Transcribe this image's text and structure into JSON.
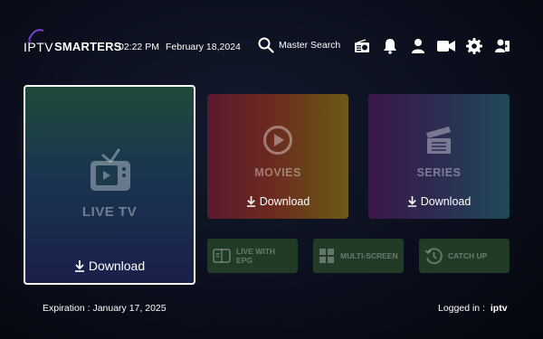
{
  "header": {
    "logo_prefix": "IPTV",
    "logo_suffix": "SMARTERS",
    "time": "02:22 PM",
    "date": "February 18,2024",
    "search_label": "Master Search",
    "icons": [
      "radio-icon",
      "bell-icon",
      "user-icon",
      "video-camera-icon",
      "gear-icon",
      "switch-user-icon"
    ]
  },
  "cards": {
    "live_tv": {
      "title": "LIVE TV",
      "action": "Download"
    },
    "movies": {
      "title": "MOVIES",
      "action": "Download"
    },
    "series": {
      "title": "SERIES",
      "action": "Download"
    }
  },
  "small_buttons": {
    "live_epg_line1": "LIVE WITH",
    "live_epg_line2": "EPG",
    "multi_screen": "MULTI-SCREEN",
    "catch_up": "CATCH UP"
  },
  "footer": {
    "expiration": "Expiration : January 17, 2025",
    "logged_in_label": "Logged in :",
    "username": "iptv"
  },
  "colors": {
    "background": "#0b0f1d",
    "small_button_bg": "#213b26",
    "selected_border": "#ffffff"
  }
}
